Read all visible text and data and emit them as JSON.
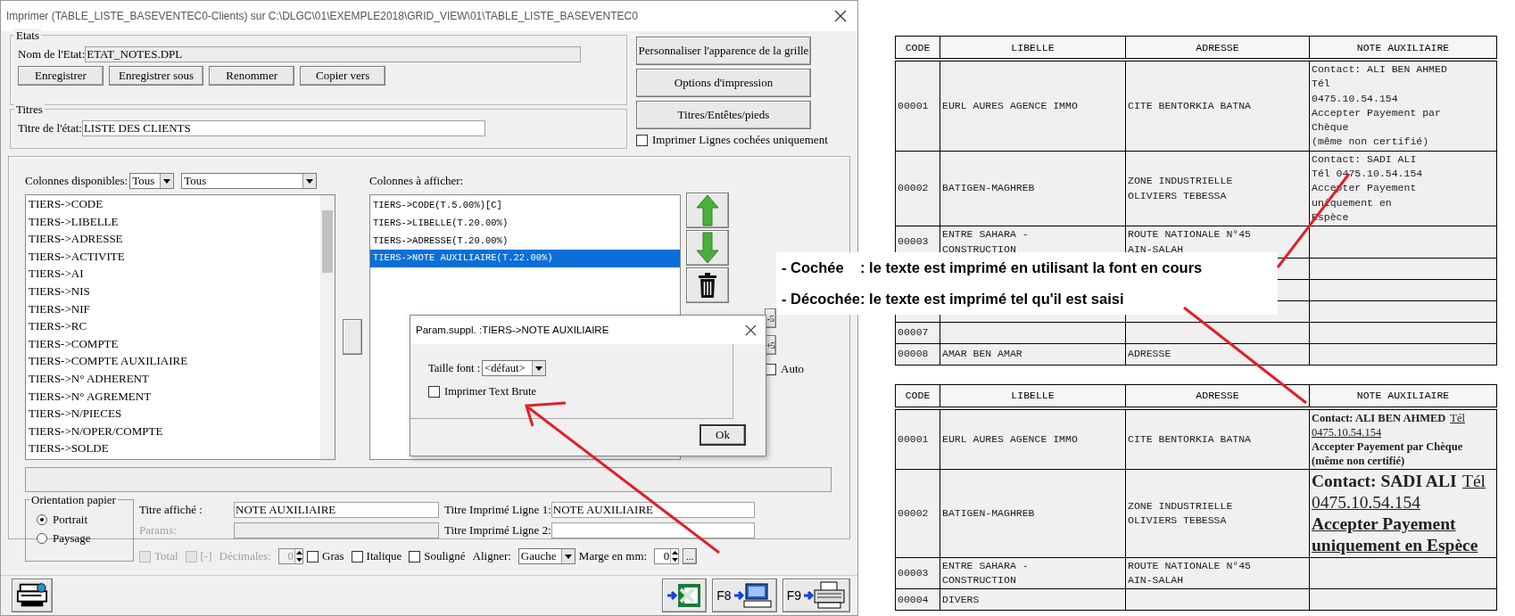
{
  "dialog": {
    "title": "Imprimer (TABLE_LISTE_BASEVENTEC0-Clients)  sur C:\\DLGC\\01\\EXEMPLE2018\\GRID_VIEW\\01\\TABLE_LISTE_BASEVENTEC0",
    "etats": {
      "legend": "Etats",
      "name_label": "Nom de l'Etat:",
      "name_value": "ETAT_NOTES.DPL",
      "buttons": [
        "Enregistrer",
        "Enregistrer sous",
        "Renommer",
        "Copier vers"
      ]
    },
    "titres": {
      "legend": "Titres",
      "title_label": "Titre de l'état:",
      "title_value": "LISTE DES CLIENTS"
    },
    "side_buttons": [
      "Personnaliser l'apparence de la grille",
      "Options d'impression",
      "Titres/Entêtes/pieds"
    ],
    "print_checked_only": {
      "label": "Imprimer Lignes cochées uniquement",
      "checked": false
    },
    "available": {
      "label": "Colonnes disponibles:",
      "filter1": "Tous",
      "filter2": "Tous",
      "items": [
        "TIERS->CODE",
        "TIERS->LIBELLE",
        "TIERS->ADRESSE",
        "TIERS->ACTIVITE",
        "TIERS->AI",
        "TIERS->NIS",
        "TIERS->NIF",
        "TIERS->RC",
        "TIERS->COMPTE",
        "TIERS->COMPTE AUXILIAIRE",
        "TIERS->N° ADHERENT",
        "TIERS->N° AGREMENT",
        "TIERS->N/PIECES",
        "TIERS->N/OPER/COMPTE",
        "TIERS->SOLDE"
      ]
    },
    "displayed": {
      "label": "Colonnes à afficher:",
      "items": [
        {
          "text": "TIERS->CODE(T.5.00%)[C]",
          "selected": false
        },
        {
          "text": "TIERS->LIBELLE(T.20.00%)",
          "selected": false
        },
        {
          "text": "TIERS->ADRESSE(T.20.00%)",
          "selected": false
        },
        {
          "text": "TIERS->NOTE AUXILIAIRE(T.22.00%)",
          "selected": true
        }
      ]
    },
    "width_buttons": [
      "-5",
      "+5"
    ],
    "auto": {
      "label": "Auto",
      "checked": false
    },
    "orientation": {
      "legend": "Orientation papier",
      "options": [
        {
          "label": "Portrait",
          "selected": true
        },
        {
          "label": "Paysage",
          "selected": false
        }
      ]
    },
    "titre_affiche": {
      "label": "Titre affiché :",
      "value": "NOTE AUXILIAIRE"
    },
    "params": {
      "label": "Params:",
      "disabled": true
    },
    "ligne1": {
      "label": "Titre Imprimé Ligne 1:",
      "value": "NOTE AUXILIAIRE"
    },
    "ligne2": {
      "label": "Titre Imprimé Ligne 2:"
    },
    "format_row": [
      {
        "kind": "checkbox",
        "label": "Total",
        "checked": false,
        "disabled": true
      },
      {
        "kind": "checkbox",
        "label": "[-]",
        "checked": false,
        "disabled": true
      },
      {
        "kind": "spinner",
        "label": "Décimales:",
        "value": "0",
        "disabled": true
      },
      {
        "kind": "checkbox",
        "label": "Gras",
        "checked": false,
        "disabled": false
      },
      {
        "kind": "checkbox",
        "label": "Italique",
        "checked": false,
        "disabled": false
      },
      {
        "kind": "checkbox",
        "label": "Souligné",
        "checked": false,
        "disabled": false
      },
      {
        "kind": "dropdown",
        "label": "Aligner:",
        "value": "Gauche"
      },
      {
        "kind": "spinner",
        "label": "Marge en mm:",
        "value": "0",
        "disabled": false
      },
      {
        "kind": "button",
        "label": "..."
      }
    ],
    "footer_buttons": [
      {
        "kind": "settings"
      },
      {
        "kind": "excel"
      },
      {
        "kind": "screen",
        "key": "F8"
      },
      {
        "kind": "printer",
        "key": "F9"
      }
    ]
  },
  "popup": {
    "title": "Param.suppl. :TIERS->NOTE AUXILIAIRE",
    "font_label": "Taille font :",
    "font_value": "<défaut>",
    "raw_text": {
      "label": "Imprimer Text Brute",
      "checked": false
    },
    "ok": "Ok"
  },
  "callout": [
    "- Cochée    : le texte est imprimé en utilisant la font en cours",
    "- Décochée: le texte est imprimé tel qu'il est saisi"
  ],
  "tables": [
    {
      "columns": [
        "CODE",
        "LIBELLE",
        "ADRESSE",
        "NOTE AUXILIAIRE"
      ],
      "rows": [
        {
          "code": "00001",
          "libelle": "EURL AURES AGENCE IMMO",
          "adresse": "CITE BENTORKIA BATNA",
          "note": "Contact: ALI BEN AHMED\nTél\n0475.10.54.154\nAccepter Payement par\nChèque\n(même non certifié)"
        },
        {
          "code": "00002",
          "libelle": "BATIGEN-MAGHREB",
          "adresse": "ZONE INDUSTRIELLE\nOLIVIERS TEBESSA",
          "note": "Contact: SADI ALI\nTél 0475.10.54.154\nAccepter Payement\nuniquement en\nEspèce"
        },
        {
          "code": "00003",
          "libelle": "ENTRE SAHARA -\nCONSTRUCTION",
          "adresse": "ROUTE NATIONALE N°45\nAIN-SALAH"
        },
        {},
        {},
        {},
        {
          "code": "00007"
        },
        {
          "code": "00008",
          "libelle": "AMAR BEN AMAR",
          "adresse": "ADRESSE"
        }
      ]
    },
    {
      "columns": [
        "CODE",
        "LIBELLE",
        "ADRESSE",
        "NOTE AUXILIAIRE"
      ],
      "rows": [
        {
          "code": "00001",
          "libelle": "EURL AURES AGENCE IMMO",
          "adresse": "CITE BENTORKIA BATNA",
          "kind": "small",
          "note_parts": [
            {
              "text": "Contact: ALI BEN AHMED",
              "kind": "bold"
            },
            {
              "text": "Tél 0475.10.54.154",
              "kind": "underline"
            },
            {
              "text": "Accepter Payement par Chèque (même non certifié)",
              "kind": "boldblock"
            }
          ]
        },
        {
          "code": "00002",
          "libelle": "BATIGEN-MAGHREB",
          "adresse": "ZONE INDUSTRIELLE\nOLIVIERS TEBESSA",
          "kind": "large",
          "note_parts": [
            {
              "text": "Contact: SADI ALI",
              "kind": "bold"
            },
            {
              "text": "Tél 0475.10.54.154",
              "kind": "underline"
            },
            {
              "text": "Accepter Payement uniquement en Espèce",
              "kind": "boldunderlineblock"
            }
          ]
        },
        {
          "code": "00003",
          "libelle": "ENTRE SAHARA -\nCONSTRUCTION",
          "adresse": "ROUTE NATIONALE N°45\nAIN-SALAH"
        },
        {
          "code": "00004",
          "libelle": "DIVERS"
        }
      ]
    }
  ]
}
